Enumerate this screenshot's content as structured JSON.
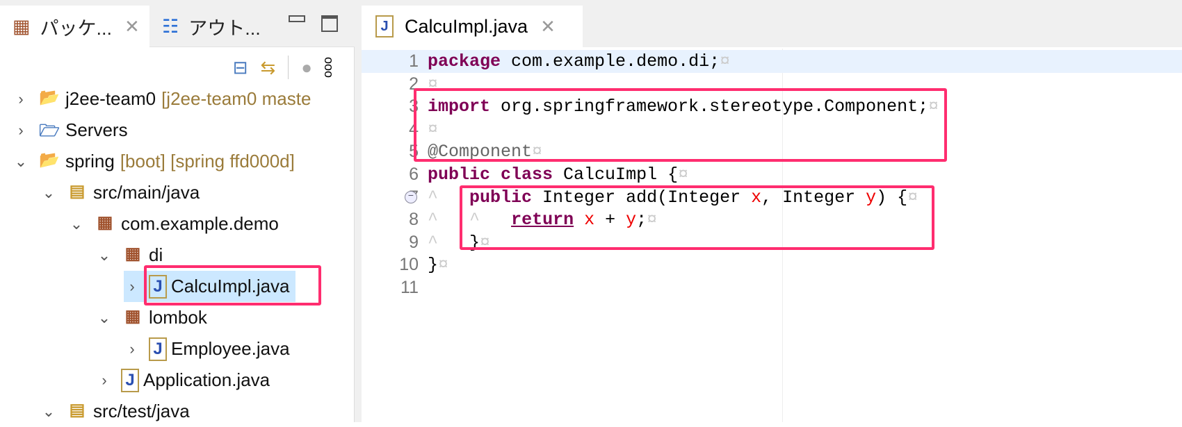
{
  "left_panel": {
    "tabs": [
      {
        "label": "パッケ...",
        "icon": "package-explorer-icon"
      },
      {
        "label": "アウト...",
        "icon": "outline-icon"
      }
    ],
    "toolbar": [
      "collapse-all-icon",
      "link-with-editor-icon",
      "filter-icon",
      "view-menu-icon"
    ],
    "tree": [
      {
        "label": "j2ee-team0",
        "decoration": "[j2ee-team0 maste",
        "expanded": false,
        "level": 0,
        "icon": "project-icon"
      },
      {
        "label": "Servers",
        "decoration": "",
        "expanded": false,
        "level": 0,
        "icon": "folder-icon"
      },
      {
        "label": "spring",
        "decoration": "[boot] [spring ffd000d]",
        "expanded": true,
        "level": 0,
        "icon": "project-icon"
      },
      {
        "label": "src/main/java",
        "decoration": "",
        "expanded": true,
        "level": 1,
        "icon": "source-folder-icon"
      },
      {
        "label": "com.example.demo",
        "decoration": "",
        "expanded": true,
        "level": 2,
        "icon": "package-icon"
      },
      {
        "label": "di",
        "decoration": "",
        "expanded": true,
        "level": 3,
        "icon": "package-icon"
      },
      {
        "label": "CalcuImpl.java",
        "decoration": "",
        "expanded": false,
        "level": 4,
        "icon": "java-file-icon",
        "selected": true
      },
      {
        "label": "lombok",
        "decoration": "",
        "expanded": true,
        "level": 3,
        "icon": "package-icon"
      },
      {
        "label": "Employee.java",
        "decoration": "",
        "expanded": false,
        "level": 4,
        "icon": "java-file-icon"
      },
      {
        "label": "Application.java",
        "decoration": "",
        "expanded": false,
        "level": 3,
        "icon": "java-file-icon"
      },
      {
        "label": "src/test/java",
        "decoration": "",
        "expanded": true,
        "level": 1,
        "icon": "source-folder-icon"
      }
    ]
  },
  "editor": {
    "tab": {
      "label": "CalcuImpl.java",
      "icon": "java-file-icon"
    },
    "lines": [
      {
        "n": "1",
        "html": "<span class='kw'>package</span> com.example.demo.di;"
      },
      {
        "n": "2",
        "html": ""
      },
      {
        "n": "3",
        "html": "<span class='kw'>import</span> org.springframework.stereotype.Component;"
      },
      {
        "n": "4",
        "html": ""
      },
      {
        "n": "5",
        "html": "<span class='ann'>@Component</span>"
      },
      {
        "n": "6",
        "html": "<span class='kw'>public</span> <span class='kw'>class</span> CalcuImpl {"
      },
      {
        "n": "7",
        "html": "<span class='eol'>^</span>   <span class='kw'>public</span> Integer add(Integer <span class='var'>x</span>, Integer <span class='var'>y</span>) {"
      },
      {
        "n": "8",
        "html": "<span class='eol'>^</span>   <span class='eol'>^</span>   <span class='kw ret'>return</span> <span class='var'>x</span> + <span class='var'>y</span>;"
      },
      {
        "n": "9",
        "html": "<span class='eol'>^</span>   }"
      },
      {
        "n": "10",
        "html": "}"
      },
      {
        "n": "11",
        "html": ""
      }
    ]
  },
  "colors": {
    "highlight_box": "#ff2d6f",
    "keyword": "#7f0055",
    "variable": "#e00000",
    "decoration": "#9a7b3a",
    "selection": "#cce8ff"
  }
}
